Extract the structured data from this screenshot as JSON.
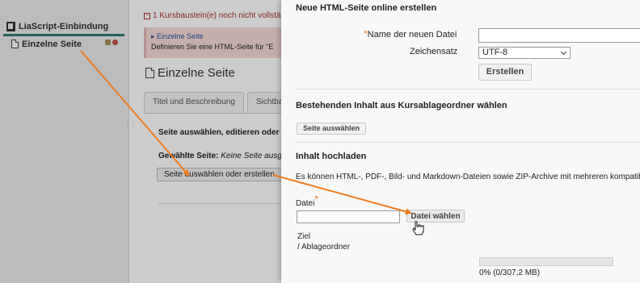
{
  "sidebar": {
    "course_title": "LiaScript-Einbindung",
    "page_item": "Einzelne Seite"
  },
  "editor": {
    "warning": "1 Kursbaustein(e) noch nicht vollstä",
    "notice_link": "Einzelne Seite",
    "notice_text": "Definieren Sie eine HTML-Seite für \"E",
    "page_title": "Einzelne Seite",
    "tabs": [
      "Titel und Beschreibung",
      "Sichtba"
    ],
    "section_heading": "Seite auswählen, editieren oder",
    "chosen_label": "Gewählte Seite:",
    "chosen_value": "Keine Seite ausge",
    "choose_button": "Seite auswählen oder erstellen"
  },
  "modal": {
    "new_section_title": "Neue HTML-Seite online erstellen",
    "filename_label": "Name der neuen Datei",
    "filename_value": "",
    "charset_label": "Zeichensatz",
    "charset_value": "UTF-8",
    "create_button": "Erstellen",
    "existing_section_title": "Bestehenden Inhalt aus Kursablageordner wählen",
    "select_page_button": "Seite auswählen",
    "upload_section_title": "Inhalt hochladen",
    "upload_description": "Es können HTML-, PDF-, Bild- und Markdown-Dateien sowie ZIP-Archive mit mehreren kompatib",
    "file_label": "Datei",
    "file_button": "Datei wählen",
    "target_label": "Ziel",
    "target_value": "/ Ablageordner",
    "quota_text": "0% (0/307,2 MB)",
    "quota_fraction": 0.0
  },
  "colors": {
    "accent_teal": "#2d7b73",
    "annotation_arrow": "#f07b1e",
    "required_marker": "#e8761d",
    "warning_red": "#a33333"
  },
  "required_marker": "*"
}
